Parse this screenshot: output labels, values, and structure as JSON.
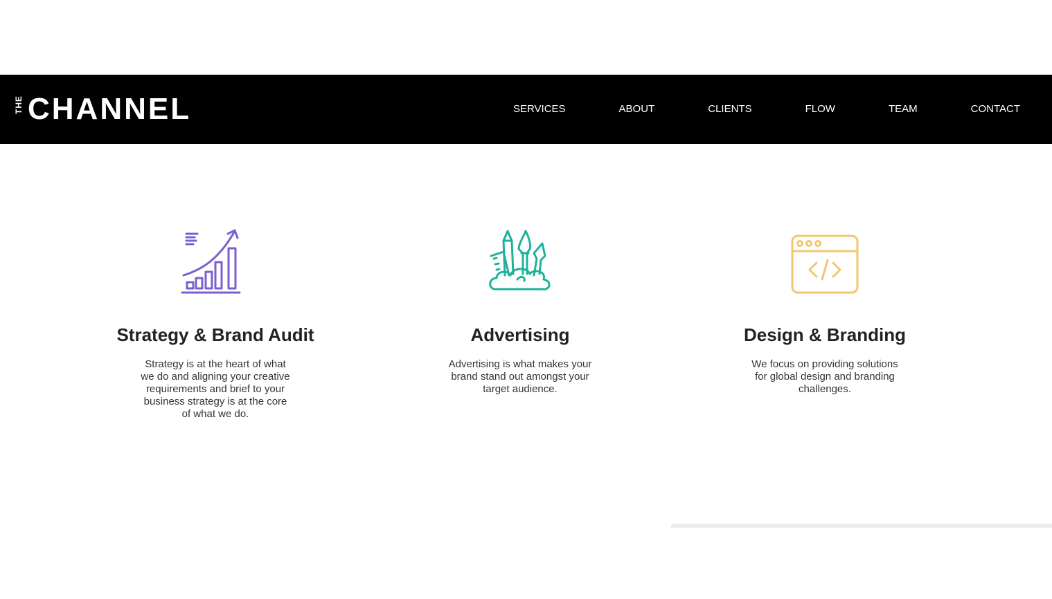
{
  "header": {
    "logo_small": "THE",
    "logo_big": "CHANNEL",
    "nav": [
      "SERVICES",
      "ABOUT",
      "CLIENTS",
      "FLOW",
      "TEAM",
      "CONTACT"
    ]
  },
  "services": [
    {
      "icon": "growth-chart-icon",
      "icon_color": "#7a5fd1",
      "title": "Strategy & Brand Audit",
      "description": "Strategy is at the heart of what we do and aligning your creative requirements and brief to your business strategy is at the core of what we do."
    },
    {
      "icon": "art-tools-icon",
      "icon_color": "#1fb29a",
      "title": "Advertising",
      "description": "Advertising is what makes your brand stand out amongst your target audience."
    },
    {
      "icon": "code-window-icon",
      "icon_color": "#f2c66d",
      "title": "Design & Branding",
      "description": "We focus on providing solutions for global design and branding challenges."
    }
  ]
}
